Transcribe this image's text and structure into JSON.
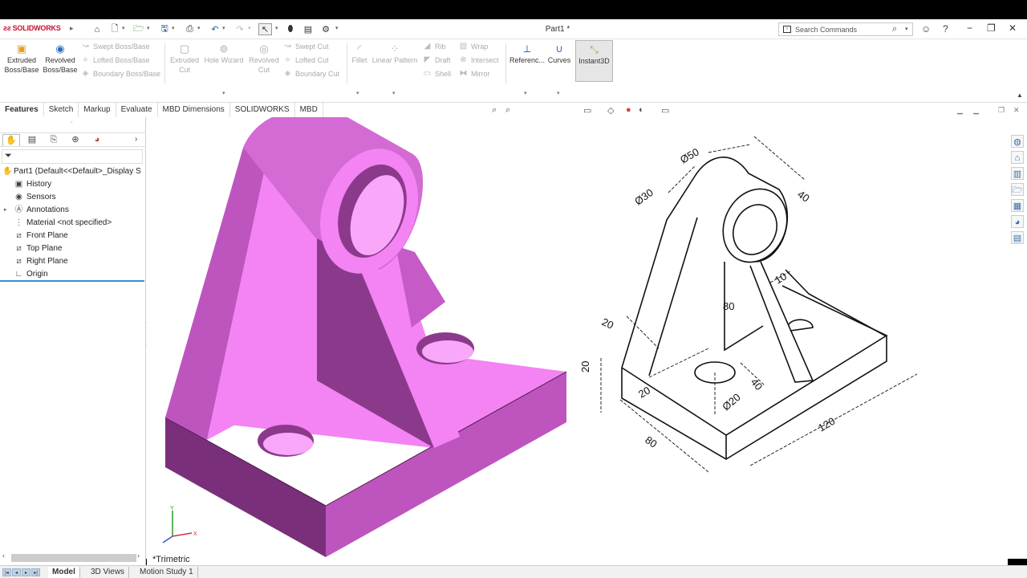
{
  "app": {
    "brand": "SOLIDWORKS",
    "document_title": "Part1 *"
  },
  "search": {
    "placeholder": "Search Commands"
  },
  "command_manager": {
    "extruded_boss": "Extruded Boss/Base",
    "revolved_boss": "Revolved Boss/Base",
    "swept_boss": "Swept Boss/Base",
    "lofted_boss": "Lofted Boss/Base",
    "boundary_boss": "Boundary Boss/Base",
    "extruded_cut": "Extruded Cut",
    "hole_wizard": "Hole Wizard",
    "revolved_cut": "Revolved Cut",
    "swept_cut": "Swept Cut",
    "lofted_cut": "Lofted Cut",
    "boundary_cut": "Boundary Cut",
    "fillet": "Fillet",
    "linear_pattern": "Linear Pattern",
    "rib": "Rib",
    "draft": "Draft",
    "shell": "Shell",
    "wrap": "Wrap",
    "intersect": "Intersect",
    "mirror": "Mirror",
    "reference": "Referenc...",
    "curves": "Curves",
    "instant3d": "Instant3D"
  },
  "tabs": [
    "Features",
    "Sketch",
    "Markup",
    "Evaluate",
    "MBD Dimensions",
    "SOLIDWORKS",
    "MBD"
  ],
  "tree": {
    "root": "Part1  (Default<<Default>_Display S",
    "items": [
      "History",
      "Sensors",
      "Annotations",
      "Material <not specified>",
      "Front Plane",
      "Top Plane",
      "Right Plane",
      "Origin"
    ]
  },
  "viewport": {
    "view_name": "*Trimetric",
    "model_color": "#f07ef0",
    "triad": {
      "x": "X",
      "y": "Y"
    }
  },
  "drawing": {
    "dims": {
      "d50": "Ø50",
      "d30": "Ø30",
      "d40_top": "40",
      "d10": "10",
      "d80_h": "80",
      "d20_left": "20",
      "d20_base": "20",
      "d20_hole": "20",
      "d40_hole": "40",
      "d_phi20": "Ø20",
      "d80_base": "80",
      "d120": "120"
    }
  },
  "bottom_tabs": [
    "Model",
    "3D Views",
    "Motion Study 1"
  ]
}
